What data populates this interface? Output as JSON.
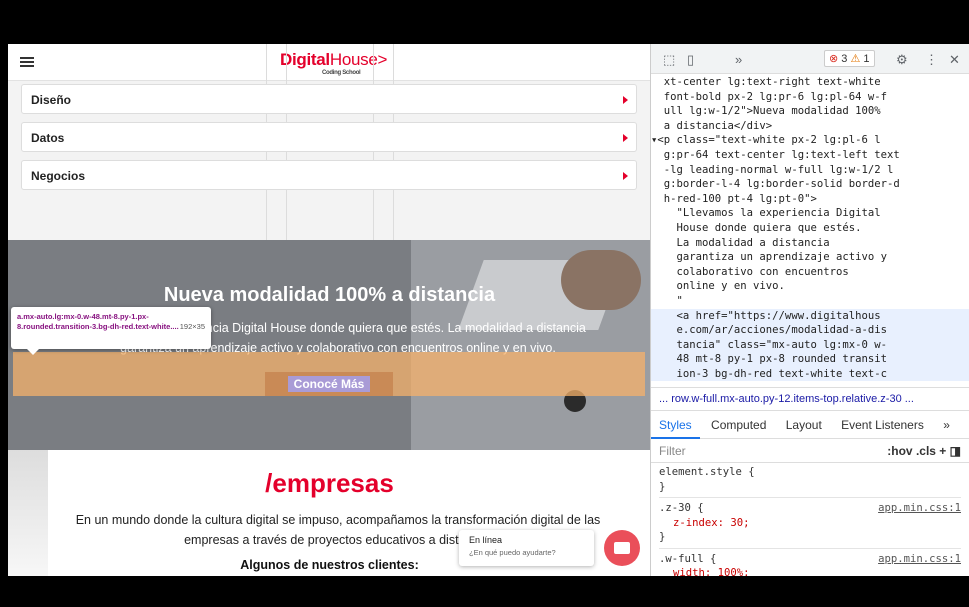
{
  "site": {
    "logo": {
      "brand_bold": "Digital",
      "brand_light": "House",
      "caret": ">",
      "tagline": "Coding School"
    },
    "accordion": [
      {
        "label": "Diseño"
      },
      {
        "label": "Datos"
      },
      {
        "label": "Negocios"
      }
    ],
    "hero": {
      "title": "Nueva modalidad 100% a distancia",
      "text": "\"Llevamos la experiencia Digital House donde quiera que estés. La modalidad a distancia garantiza un aprendizaje activo y colaborativo con encuentros online y en vivo.",
      "button": "Conocé Más"
    },
    "tooltip": {
      "selector": "a.mx-auto.lg:mx-0.w-48.mt-8.py-1.px-8.rounded.transition-3.bg-dh-red.text-white....",
      "dims": "192×35"
    },
    "empresas": {
      "title": "/empresas",
      "text": "En un mundo donde la cultura digital se impuso, acompañamos la transformación digital de las empresas a través de proyectos educativos a distancia.",
      "subtitle": "Algunos de nuestros clientes:"
    },
    "chat": {
      "title": "En línea",
      "subtitle": "¿En qué puedo ayudarte?"
    }
  },
  "devtools": {
    "toolbar": {
      "more": "»",
      "errors": "3",
      "warnings": "1"
    },
    "dom_lines": [
      "  xt-center lg:text-right text-white",
      "  font-bold px-2 lg:pr-6 lg:pl-64 w-f",
      "  ull lg:w-1/2\">Nueva modalidad 100%",
      "  a distancia</div>",
      "▾<p class=\"text-white px-2 lg:pl-6 l",
      "  g:pr-64 text-center lg:text-left text",
      "  -lg leading-normal w-full lg:w-1/2 l",
      "  g:border-l-4 lg:border-solid border-d",
      "  h-red-100 pt-4 lg:pt-0\">",
      "    \"Llevamos la experiencia Digital",
      "    House donde quiera que estés.",
      "    La modalidad a distancia",
      "    garantiza un aprendizaje activo y",
      "    colaborativo con encuentros",
      "    online y en vivo.",
      "    \"",
      "    <a href=\"https://www.digitalhous",
      "    e.com/ar/acciones/modalidad-a-dis",
      "    tancia\" class=\"mx-auto lg:mx-0 w-",
      "    48 mt-8 py-1 px-8 rounded transit",
      "    ion-3 bg-dh-red text-white text-c"
    ],
    "breadcrumb": "...  row.w-full.mx-auto.py-12.items-top.relative.z-30  ...",
    "tabs": [
      "Styles",
      "Computed",
      "Layout",
      "Event Listeners",
      "»"
    ],
    "filter": {
      "placeholder": "Filter",
      "hov": ":hov",
      "cls": ".cls",
      "plus": "+"
    },
    "styles": [
      {
        "selector": "element.style {",
        "decl": "",
        "close": "}",
        "source": ""
      },
      {
        "selector": ".z-30 {",
        "decl": "z-index: 30;",
        "close": "}",
        "source": "app.min.css:1"
      },
      {
        "selector": ".w-full {",
        "decl": "width: 100%;",
        "close": "",
        "source": "app.min.css:1"
      }
    ]
  }
}
